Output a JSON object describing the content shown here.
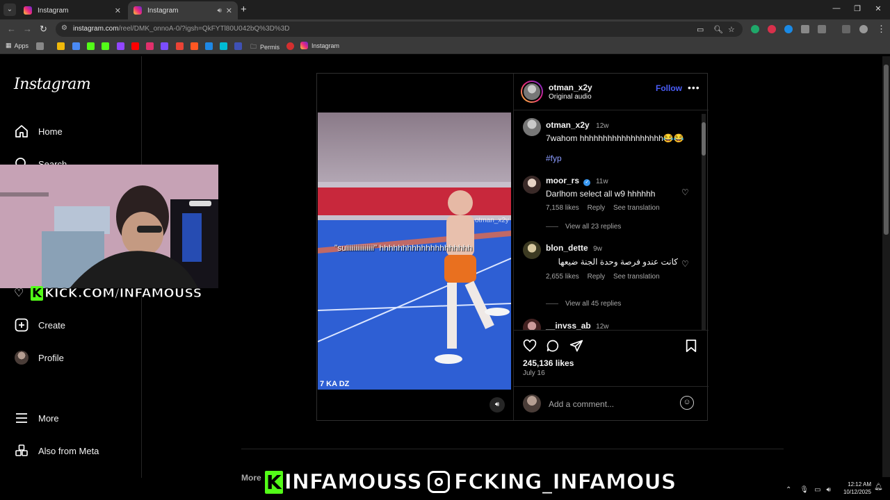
{
  "browser": {
    "tabs": [
      {
        "title": "Instagram",
        "active": false
      },
      {
        "title": "Instagram",
        "active": true
      }
    ],
    "url_main": "instagram.com",
    "url_path": "/reel/DMK_onnoA-0/?igsh=QkFYTl80U042bQ%3D%3D",
    "bookmarks": {
      "apps": "Apps",
      "permis": "Permis",
      "instagram": "Instagram"
    }
  },
  "instagram": {
    "logo": "Instagram",
    "nav": {
      "home": "Home",
      "search": "Search",
      "create": "Create",
      "profile": "Profile",
      "more": "More",
      "meta": "Also from Meta"
    },
    "post": {
      "author": "otman_x2y",
      "audio": "Original audio",
      "follow": "Follow",
      "video_caption": "\"suiiiiiiiiiiiiiii\" hhhhhhhhhhhhhhhhhhhh",
      "video_watermark": "otman_x2y",
      "video_corner_text": "7 KA DZ",
      "likes": "245,136 likes",
      "date": "July 16",
      "add_comment": "Add a comment..."
    },
    "comments": [
      {
        "user": "otman_x2y",
        "age": "12w",
        "text": "7wahom hhhhhhhhhhhhhhhhhh😂😂",
        "tag": "#fyp"
      },
      {
        "user": "moor_rs",
        "verified": true,
        "age": "11w",
        "text": "Darlhom select all w9 hhhhhh",
        "likes": "7,158 likes",
        "reply": "Reply",
        "translate": "See translation",
        "view_replies": "View all 23 replies"
      },
      {
        "user": "blon_dette",
        "age": "9w",
        "text": "كانت عندو فرصة وحدة الجنة ضيعها",
        "likes": "2,655 likes",
        "reply": "Reply",
        "translate": "See translation",
        "view_replies": "View all 45 replies"
      },
      {
        "user": "__invss_ab",
        "age": "12w",
        "text": "😂😂😂😂"
      }
    ],
    "more_from": "More"
  },
  "overlays": {
    "webcam_kick": "KICK.COM/INFAMOUSS",
    "banner_kick": "INFAMOUSS",
    "banner_ig": "FCKING_INFAMOUS"
  },
  "system": {
    "time": "12:12 AM",
    "date": "10/12/2025"
  },
  "colors": {
    "accent": "#4a5df9",
    "kick": "#53fc18",
    "ig_gradient": [
      "#f9ce34",
      "#ee2a7b",
      "#6228d7"
    ]
  }
}
